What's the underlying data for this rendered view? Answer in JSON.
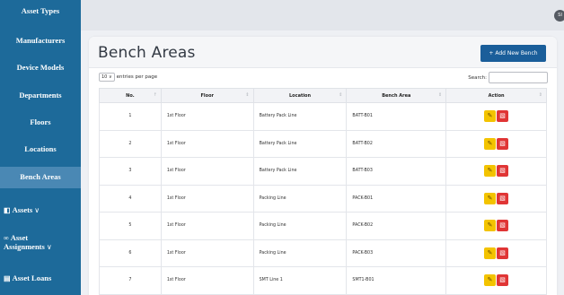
{
  "sidebar": {
    "items": [
      {
        "label": "Asset Types"
      },
      {
        "label": "Manufacturers"
      },
      {
        "label": "Device Models"
      },
      {
        "label": "Departments"
      },
      {
        "label": "Floors"
      },
      {
        "label": "Locations"
      },
      {
        "label": "Bench Areas",
        "active": true
      },
      {
        "label": "Assets",
        "icon": "devices-icon",
        "has_chevron": true
      },
      {
        "label_line1": "Asset",
        "label_line2": "Assignments",
        "icon": "link-icon",
        "has_chevron": true
      },
      {
        "label": "Asset Loans",
        "icon": "calendar-icon"
      }
    ]
  },
  "topbar": {
    "avatar_initials": "SI"
  },
  "page": {
    "title": "Bench Areas",
    "add_button_label": "+ Add New Bench",
    "entries_value": "10",
    "entries_suffix": "entries per page",
    "search_label": "Search:",
    "search_placeholder": ""
  },
  "table": {
    "columns": [
      "No.",
      "Floor",
      "Location",
      "Bench Area",
      "Action"
    ],
    "rows": [
      {
        "no": "1",
        "floor": "1st Floor",
        "location": "Battery Pack Line",
        "bench": "BATT-B01"
      },
      {
        "no": "2",
        "floor": "1st Floor",
        "location": "Battery Pack Line",
        "bench": "BATT-B02"
      },
      {
        "no": "3",
        "floor": "1st Floor",
        "location": "Battery Pack Line",
        "bench": "BATT-B03"
      },
      {
        "no": "4",
        "floor": "1st Floor",
        "location": "Packing Line",
        "bench": "PACK-B01"
      },
      {
        "no": "5",
        "floor": "1st Floor",
        "location": "Packing Line",
        "bench": "PACK-B02"
      },
      {
        "no": "6",
        "floor": "1st Floor",
        "location": "Packing Line",
        "bench": "PACK-B03"
      },
      {
        "no": "7",
        "floor": "1st Floor",
        "location": "SMT Line 1",
        "bench": "SMT1-B01"
      }
    ]
  },
  "icons": {
    "edit": "pencil-icon",
    "delete": "trash-icon"
  },
  "colors": {
    "sidebar": "#1d6a9a",
    "sidebar_active": "#4a88b4",
    "primary_button": "#1a5e9a",
    "edit": "#f3c300",
    "delete": "#e03535"
  }
}
